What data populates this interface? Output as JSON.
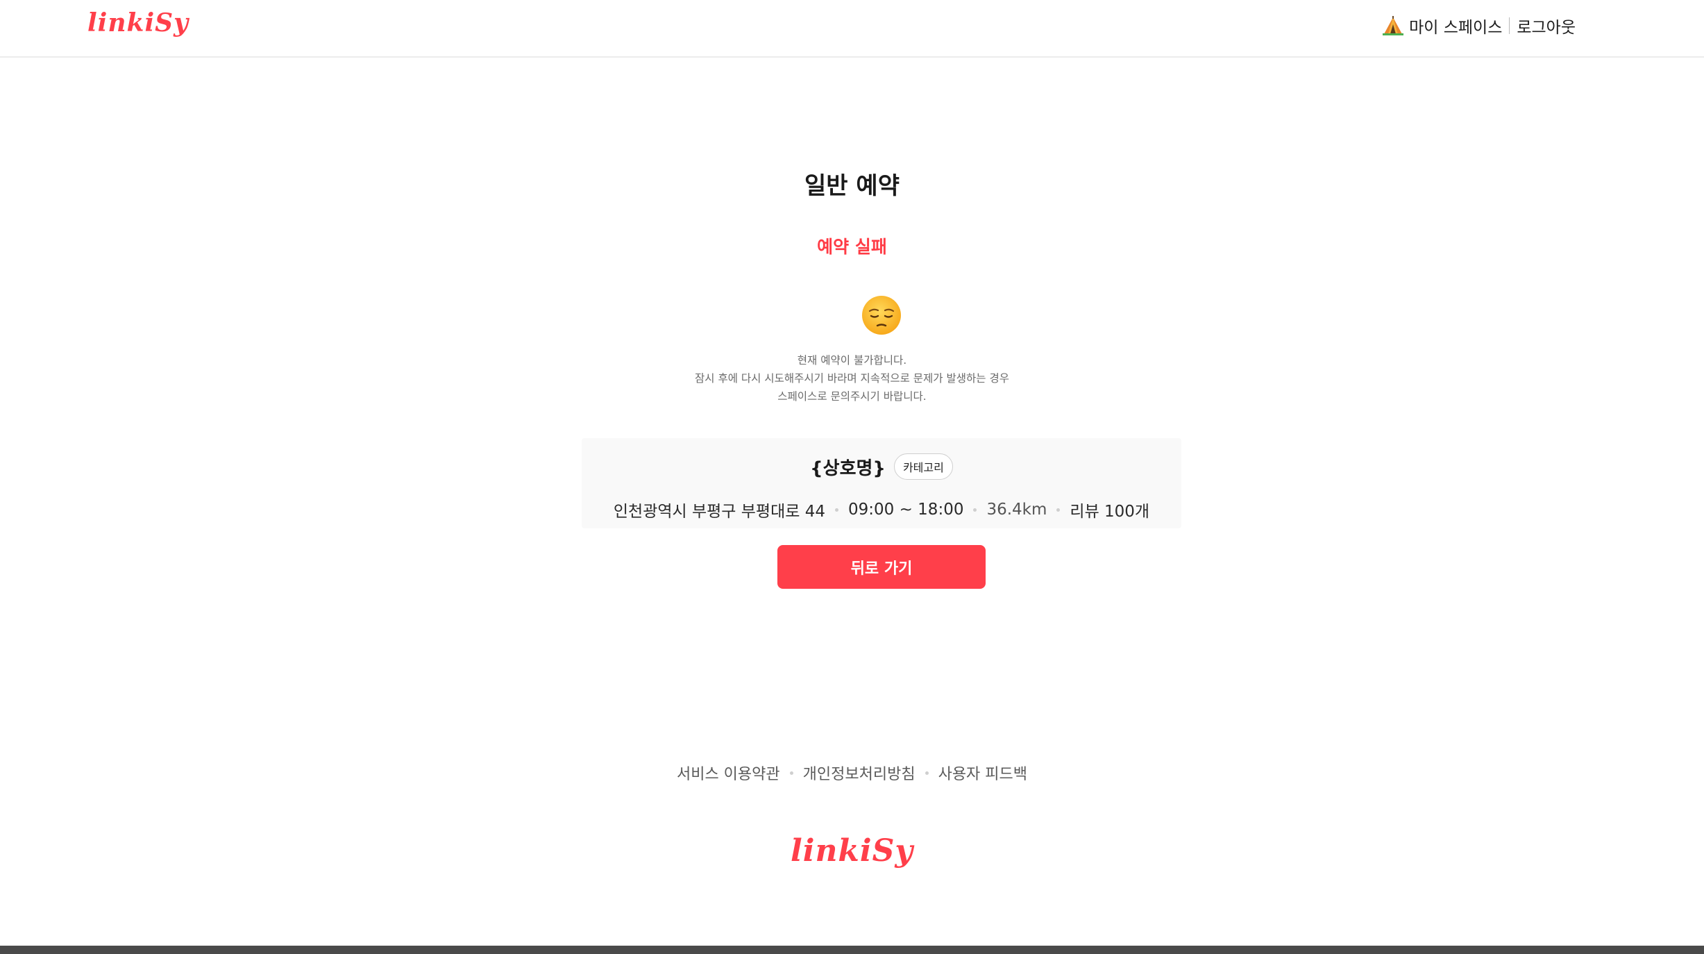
{
  "header": {
    "logo": "linkiSy",
    "nav": {
      "my_space": "마이 스페이스",
      "logout": "로그아웃",
      "my_space_icon": "tent-icon"
    }
  },
  "main": {
    "title": "일반 예약",
    "status": "예약 실패",
    "emoji_icon": "pensive-face-icon",
    "message_lines": [
      "현재 예약이 불가합니다.",
      "잠시 후에 다시 시도해주시기 바라며 지속적으로 문제가 발생하는 경우",
      "스페이스로 문의주시기 바랍니다."
    ],
    "card": {
      "shop_name": "{상호명}",
      "category": "카테고리",
      "address": "인천광역시 부평구 부평대로 44",
      "hours": "09:00 ~ 18:00",
      "distance": "36.4km",
      "reviews": "리뷰 100개"
    },
    "back_button": "뒤로 가기"
  },
  "footer": {
    "links": [
      "서비스 이용약관",
      "개인정보처리방침",
      "사용자 피드백"
    ],
    "logo": "linkiSy"
  },
  "colors": {
    "accent": "#ff3f4a",
    "card_bg": "#f9f9f9"
  }
}
